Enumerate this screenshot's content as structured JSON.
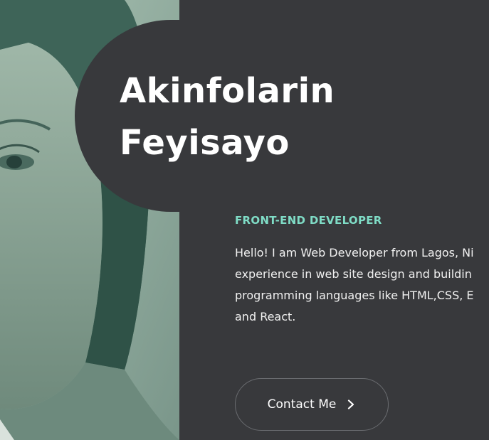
{
  "hero": {
    "name_line1": "Akinfolarin",
    "name_line2": "Feyisayo",
    "role": "FRONT-END DEVELOPER",
    "bio_lines": [
      "Hello! I am Web Developer from Lagos, Ni",
      "experience in web site design and buildin",
      "programming languages like HTML,CSS, E",
      "and React."
    ],
    "contact_label": "Contact Me",
    "contact_icon": "chevron-right-icon"
  },
  "colors": {
    "background": "#38393c",
    "accent": "#7fdcc6",
    "text": "#ffffff"
  }
}
